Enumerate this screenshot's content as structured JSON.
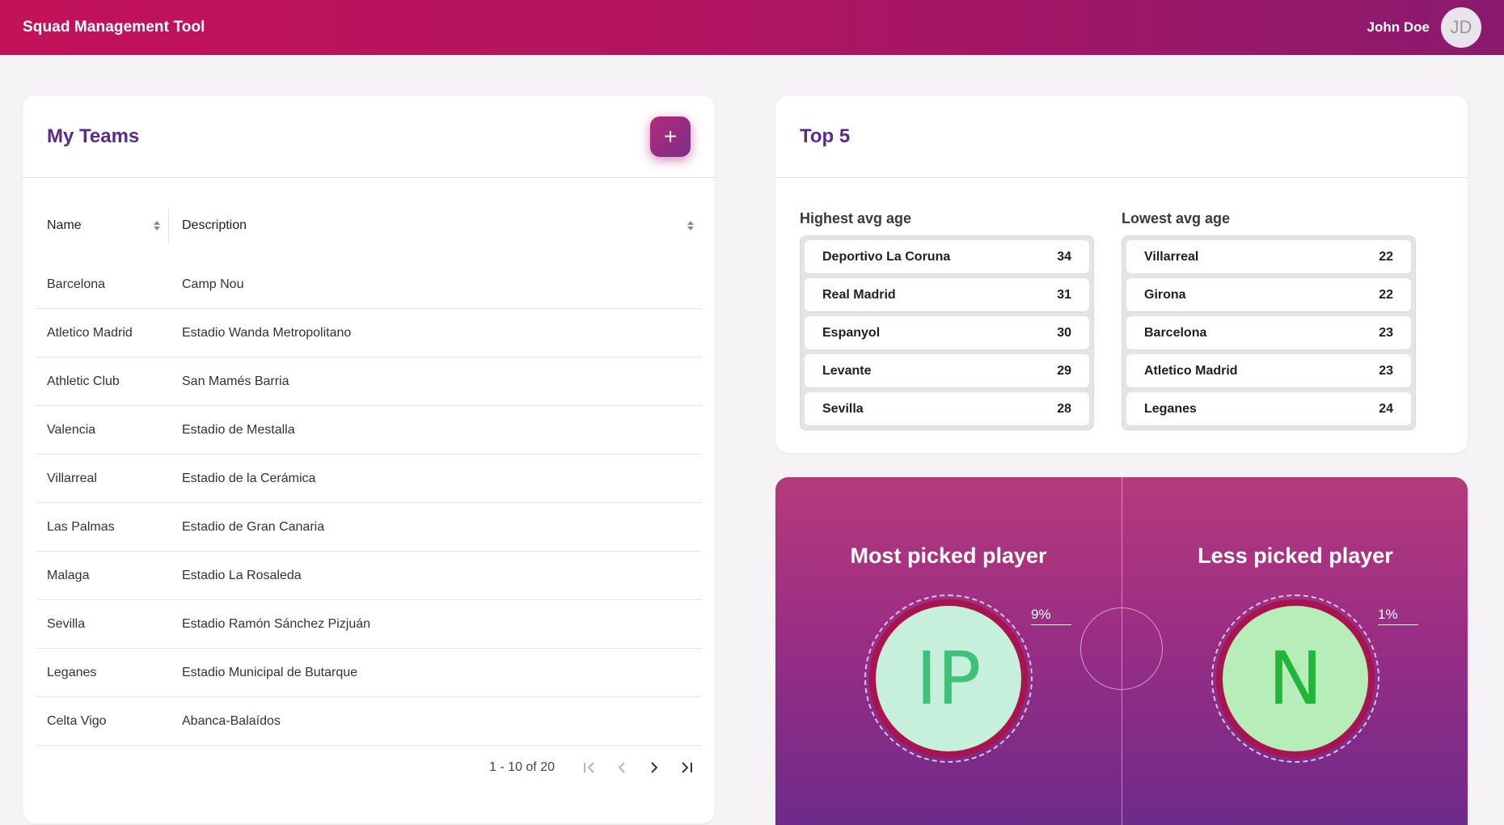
{
  "header": {
    "title": "Squad Management Tool",
    "user_name": "John Doe",
    "user_initials": "JD"
  },
  "teams": {
    "title": "My Teams",
    "add_label": "+",
    "columns": {
      "name": "Name",
      "description": "Description"
    },
    "rows": [
      {
        "name": "Barcelona",
        "description": "Camp Nou"
      },
      {
        "name": "Atletico Madrid",
        "description": "Estadio Wanda Metropolitano"
      },
      {
        "name": "Athletic Club",
        "description": "San Mamés Barria"
      },
      {
        "name": "Valencia",
        "description": "Estadio de Mestalla"
      },
      {
        "name": "Villarreal",
        "description": "Estadio de la Cerámica"
      },
      {
        "name": "Las Palmas",
        "description": "Estadio de Gran Canaria"
      },
      {
        "name": "Malaga",
        "description": "Estadio La Rosaleda"
      },
      {
        "name": "Sevilla",
        "description": "Estadio Ramón Sánchez Pizjuán"
      },
      {
        "name": "Leganes",
        "description": "Estadio Municipal de Butarque"
      },
      {
        "name": "Celta Vigo",
        "description": "Abanca-Balaídos"
      }
    ],
    "pagination": {
      "range": "1 - 10 of 20"
    }
  },
  "top5": {
    "title": "Top 5",
    "highest": {
      "title": "Highest avg age",
      "items": [
        {
          "team": "Deportivo La Coruna",
          "value": "34"
        },
        {
          "team": "Real Madrid",
          "value": "31"
        },
        {
          "team": "Espanyol",
          "value": "30"
        },
        {
          "team": "Levante",
          "value": "29"
        },
        {
          "team": "Sevilla",
          "value": "28"
        }
      ]
    },
    "lowest": {
      "title": "Lowest avg age",
      "items": [
        {
          "team": "Villarreal",
          "value": "22"
        },
        {
          "team": "Girona",
          "value": "22"
        },
        {
          "team": "Barcelona",
          "value": "23"
        },
        {
          "team": "Atletico Madrid",
          "value": "23"
        },
        {
          "team": "Leganes",
          "value": "24"
        }
      ]
    }
  },
  "picks": {
    "most": {
      "title": "Most picked player",
      "initials": "IP",
      "percent": "9%",
      "face_color": "#c6f0dc",
      "text_color": "#3fc17a"
    },
    "less": {
      "title": "Less picked player",
      "initials": "N",
      "percent": "1%",
      "face_color": "#b6edb9",
      "text_color": "#22b53a"
    }
  },
  "colors": {
    "accent": "#5b2a8c",
    "header_start": "#c2125a",
    "header_end": "#8a1a6e"
  }
}
